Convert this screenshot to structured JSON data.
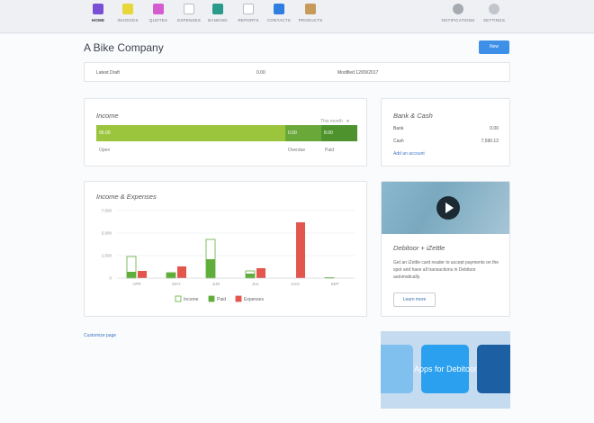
{
  "nav": {
    "items": [
      {
        "label": "HOME",
        "icon": "bar-chart-icon",
        "color": "#7a4fd6"
      },
      {
        "label": "INVOICES",
        "icon": "invoice-icon",
        "color": "#e8d73a"
      },
      {
        "label": "QUOTES",
        "icon": "quote-icon",
        "color": "#d45bd0"
      },
      {
        "label": "EXPENSES",
        "icon": "expense-icon",
        "color": "#c9cdd2"
      },
      {
        "label": "BANKING",
        "icon": "bank-icon",
        "color": "#2a9a8a"
      },
      {
        "label": "REPORTS",
        "icon": "report-icon",
        "color": "#c4c8ce"
      },
      {
        "label": "CONTACTS",
        "icon": "contacts-icon",
        "color": "#2f7de0"
      },
      {
        "label": "PRODUCTS",
        "icon": "box-icon",
        "color": "#c79a5a"
      }
    ],
    "notifications_label": "NOTIFICATIONS",
    "settings_label": "SETTINGS"
  },
  "header": {
    "company": "A Bike Company",
    "new_button": "New"
  },
  "draft": {
    "label": "Latest Draft",
    "amount": "0.00",
    "modified": "Modified 12/09/2017"
  },
  "income": {
    "title": "Income",
    "period": "This month",
    "open_value": "95.00",
    "overdue_value": "0.00",
    "paid_value": "8.00",
    "open_label": "Open",
    "overdue_label": "Overdue",
    "paid_label": "Paid"
  },
  "bank": {
    "title": "Bank & Cash",
    "rows": [
      {
        "label": "Bank",
        "value": "0.00"
      },
      {
        "label": "Cash",
        "value": "7,590.12"
      }
    ],
    "add_link": "Add an account"
  },
  "colors": {
    "income_open": "#9bc53d",
    "income_dark": "#5a9a2e",
    "paid": "#5fad3b",
    "expenses": "#e2564e",
    "accent": "#3d8fe8"
  },
  "chart_data": {
    "type": "bar",
    "title": "Income & Expenses",
    "categories": [
      "APR",
      "MAY",
      "JUN",
      "JUL",
      "AUG",
      "SEP"
    ],
    "yticks": [
      "7,500",
      "5,000",
      "2,500",
      "0"
    ],
    "ylim": [
      0,
      7500
    ],
    "series": [
      {
        "name": "Income",
        "values": [
          2400,
          600,
          4300,
          800,
          0,
          50
        ]
      },
      {
        "name": "Paid",
        "values": [
          700,
          600,
          2100,
          500,
          0,
          0
        ]
      },
      {
        "name": "Expenses",
        "values": [
          800,
          1300,
          0,
          1100,
          6200,
          0
        ]
      }
    ],
    "legend": "bottom"
  },
  "promo": {
    "title": "Debitoor + iZettle",
    "body": "Get an iZettle card reader to accept payments on the spot and have all transactions in Debitoor automatically.",
    "button": "Learn more"
  },
  "customize_link": "Customize page",
  "apps_banner": "Apps for Debitoor"
}
